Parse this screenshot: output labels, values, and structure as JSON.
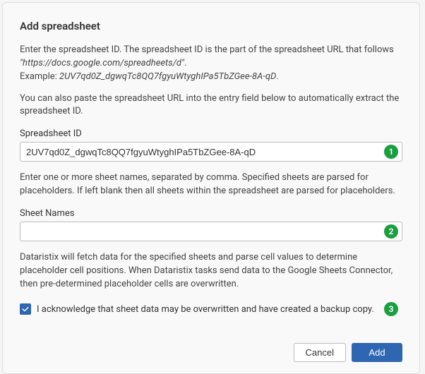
{
  "dialog": {
    "title": "Add spreadsheet",
    "intro_line1": "Enter the spreadsheet ID. The spreadsheet ID is the part of the spreadsheet URL that follows",
    "intro_url": "\"https://docs.google.com/spreadheets/d\"",
    "intro_line1_end": ".",
    "example_prefix": "Example: ",
    "example_id": "2UV7qd0Z_dgwqTc8QQ7fgyuWtyghIPa5TbZGee-8A-qD",
    "example_suffix": ".",
    "intro2": "You can also paste the spreadsheet URL into the entry field below to automatically extract the spreadsheet ID.",
    "field1": {
      "label": "Spreadsheet ID",
      "value": "2UV7qd0Z_dgwqTc8QQ7fgyuWtyghIPa5TbZGee-8A-qD",
      "badge": "1"
    },
    "help1": "Enter one or more sheet names, separated by comma. Specified sheets are parsed for placeholders. If left blank then all sheets within the spreadsheet are parsed for placeholders.",
    "field2": {
      "label": "Sheet Names",
      "value": "",
      "badge": "2"
    },
    "help2": "Dataristix will fetch data for the specified sheets and parse cell values to determine placeholder cell positions. When Dataristix tasks send data to the Google Sheets Connector, then pre-determined placeholder cells are overwritten.",
    "acknowledge": {
      "label": "I acknowledge that sheet data may be overwritten and have created a backup copy.",
      "checked": true,
      "badge": "3"
    },
    "buttons": {
      "cancel": "Cancel",
      "add": "Add"
    }
  }
}
